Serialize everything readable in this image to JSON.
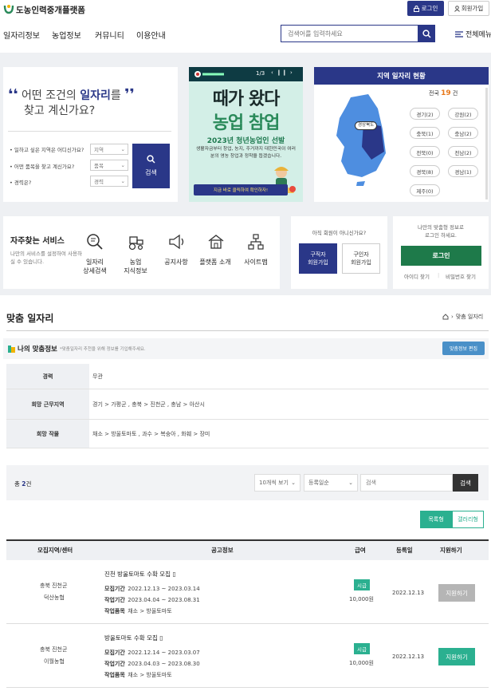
{
  "header": {
    "site_name": "도농인력중개플랫폼",
    "login_label": "로그인",
    "join_label": "회원가입",
    "nav": [
      "일자리정보",
      "농업정보",
      "커뮤니티",
      "이용안내"
    ],
    "search_placeholder": "검색어를 입력하세요",
    "all_menu_label": "전체메뉴",
    "brand_color": "#2a3788"
  },
  "quick_search": {
    "title_pre": "어떤 조건의 ",
    "title_highlight": "일자리",
    "title_post": "를",
    "title_line2": "찾고 계신가요?",
    "fields": [
      {
        "label": "• 일하고 싶은 지역은 어디신가요?",
        "value": "지역"
      },
      {
        "label": "• 어떤 품목을 찾고 계신가요?",
        "value": "품목"
      },
      {
        "label": "• 경력은?",
        "value": "경력"
      }
    ],
    "search_label": "검색"
  },
  "banner": {
    "counter": "1/3",
    "heading1": "때가 왔다",
    "heading2": "농업 참업",
    "subheading": "2023년 청년농업인 선발",
    "description": "생활자금부터 창업, 농지, 주거까지 대한민국이 여러분의 영농 창업과 정착을 돕겠습니다.",
    "cta": "지금 바로 클릭하여 확인하자!"
  },
  "region_status": {
    "title": "지역 일자리 현황",
    "total_prefix": "전국 ",
    "total_count": "19",
    "total_suffix": " 건",
    "map_label": "경상북도",
    "regions": [
      "경기(2)",
      "강원(2)",
      "충북(1)",
      "충남(2)",
      "전북(0)",
      "전남(2)",
      "경북(8)",
      "경남(1)",
      "제주(0)"
    ]
  },
  "services": {
    "title": "자주찾는 서비스",
    "description": "나만의 서비스를 설정하여 사용하실 수 있습니다.",
    "items": [
      {
        "line1": "일자리",
        "line2": "상세검색",
        "icon": "search-magnifier-icon"
      },
      {
        "line1": "농업",
        "line2": "지식정보",
        "icon": "tractor-icon"
      },
      {
        "line1": "공지사항",
        "line2": "",
        "icon": "megaphone-icon"
      },
      {
        "line1": "플랫폼 소개",
        "line2": "",
        "icon": "house-icon"
      },
      {
        "line1": "사이트맵",
        "line2": "",
        "icon": "sitemap-icon"
      }
    ]
  },
  "member": {
    "question": "아직 회원이 아니신가요?",
    "seeker_line1": "구직자",
    "seeker_line2": "회원가입",
    "employer_line1": "구인자",
    "employer_line2": "회원가입"
  },
  "login_card": {
    "text_line1": "나만의 맞춤형 정보로",
    "text_line2": "로그인 하세요.",
    "login_label": "로그인",
    "find_id": "아이디 찾기",
    "find_pw": "비밀번호 찾기"
  },
  "section": {
    "title": "맞춤 일자리",
    "breadcrumb": "맞춤 일자리"
  },
  "my_info": {
    "title": "나의 맞춤정보",
    "note": "*맞춤일자리 추천을 위해 정보를 기입해주세요.",
    "edit_label": "맞춤정보 편집",
    "rows": [
      {
        "label": "경력",
        "value": "무관"
      },
      {
        "label": "희망 근무지역",
        "value": "경기 > 가평군 , 충북 > 진천군 , 충남 > 아산시"
      },
      {
        "label": "희망 작물",
        "value": "채소 > 방울토마토 , 과수 > 복숭아 , 화훼 > 장미"
      }
    ]
  },
  "list_filter": {
    "total_label": "총 ",
    "total_count": "2",
    "total_suffix": "건",
    "page_size": "10개씩 보기",
    "sort": "등록일순",
    "search_placeholder": "검색",
    "search_label": "검색",
    "view_list": "목록형",
    "view_gallery": "갤러리형"
  },
  "table": {
    "headers": [
      "모집지역/센터",
      "공고정보",
      "급여",
      "등록일",
      "지원하기"
    ],
    "rows": [
      {
        "region": "충북 진천군",
        "center": "덕산농협",
        "title": "진천 방울토마토 수확 모집",
        "recruit_key": "모집기간",
        "recruit": "2022.12.13 ~ 2023.03.14",
        "work_key": "작업기간",
        "work": "2023.04.04 ~ 2023.08.31",
        "item_key": "작업품목",
        "item": "채소 > 방울토마토",
        "wage_type": "시급",
        "wage": "10,000원",
        "date": "2022.12.13",
        "apply": "지원하기",
        "apply_active": false
      },
      {
        "region": "충북 진천군",
        "center": "이월농협",
        "title": "방울토마토 수확 모집",
        "recruit_key": "모집기간",
        "recruit": "2022.12.14 ~ 2023.03.07",
        "work_key": "작업기간",
        "work": "2023.04.03 ~ 2023.08.30",
        "item_key": "작업품목",
        "item": "채소 > 방울토마토",
        "wage_type": "시급",
        "wage": "10,000원",
        "date": "2022.12.13",
        "apply": "지원하기",
        "apply_active": true
      }
    ]
  }
}
